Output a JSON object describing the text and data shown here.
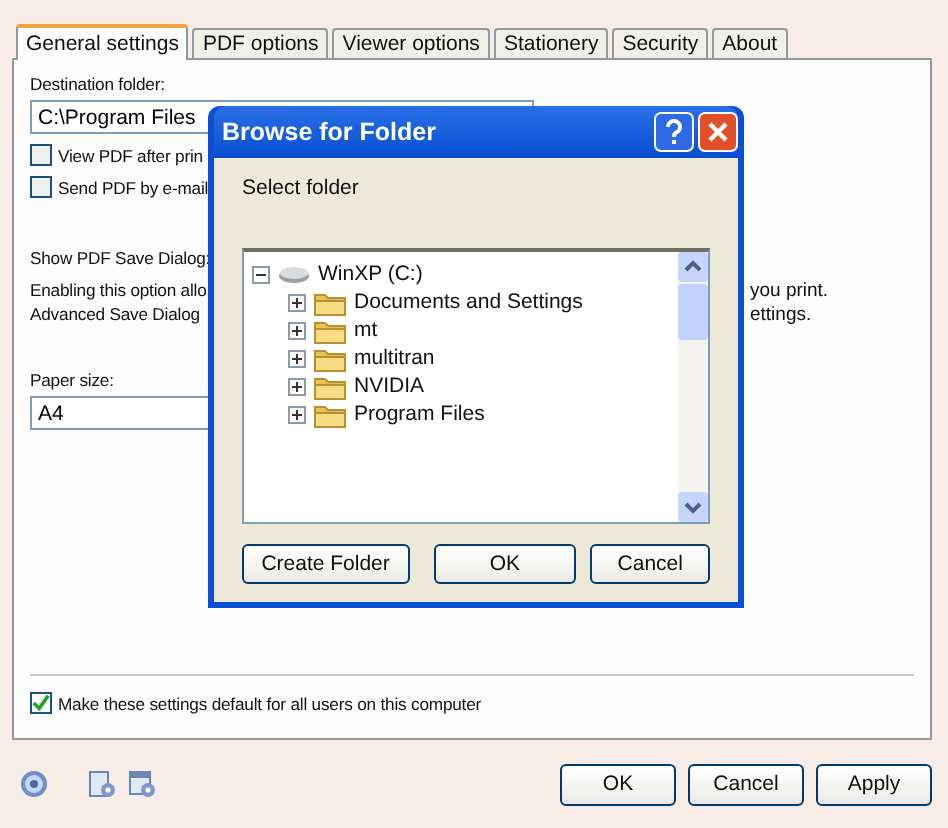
{
  "tabs": [
    {
      "label": "General settings",
      "selected": true
    },
    {
      "label": "PDF options",
      "selected": false
    },
    {
      "label": "Viewer options",
      "selected": false
    },
    {
      "label": "Stationery",
      "selected": false
    },
    {
      "label": "Security",
      "selected": false
    },
    {
      "label": "About",
      "selected": false
    }
  ],
  "destination": {
    "label": "Destination folder:",
    "value": "C:\\Program Files"
  },
  "options": [
    {
      "label": "View PDF after prin",
      "checked": false
    },
    {
      "label": "Send PDF by e-mail",
      "checked": false
    }
  ],
  "save_dialog": {
    "label": "Show PDF Save Dialog:",
    "description": [
      {
        "left": "Enabling this option allo",
        "right": "you print."
      },
      {
        "left": "Advanced Save Dialog",
        "right": "ettings."
      }
    ]
  },
  "paper_size": {
    "label": "Paper size:",
    "value": "A4"
  },
  "default_all_users": {
    "label": "Make these settings default for all users on this computer",
    "checked": true
  },
  "buttons": [
    "OK",
    "Cancel",
    "Apply"
  ],
  "dialog": {
    "title": "Browse for Folder",
    "prompt": "Select folder",
    "tree": [
      {
        "label": "WinXP (C:)",
        "kind": "drive",
        "expanded": true,
        "children": [
          {
            "label": "Documents and Settings",
            "kind": "folder",
            "expanded": false
          },
          {
            "label": "mt",
            "kind": "folder",
            "expanded": false
          },
          {
            "label": "multitran",
            "kind": "folder",
            "expanded": false
          },
          {
            "label": "NVIDIA",
            "kind": "folder",
            "expanded": false
          },
          {
            "label": "Program Files",
            "kind": "folder",
            "expanded": false
          }
        ]
      }
    ],
    "buttons": [
      "Create  Folder",
      "OK",
      "Cancel"
    ]
  }
}
